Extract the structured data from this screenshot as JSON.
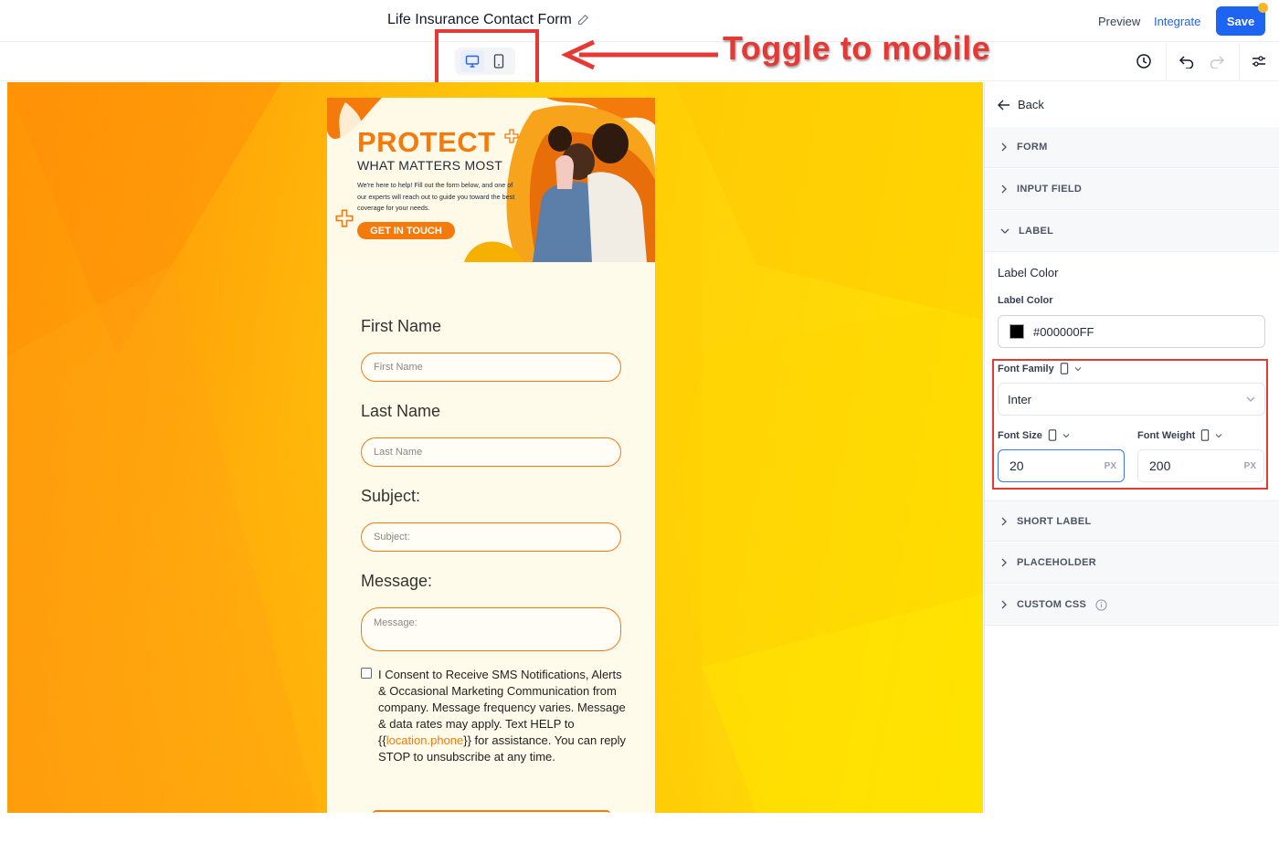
{
  "header": {
    "form_title": "Life Insurance Contact Form",
    "preview_label": "Preview",
    "integrate_label": "Integrate",
    "save_label": "Save"
  },
  "annotation": {
    "toggle_text": "Toggle to mobile",
    "color": "#e53935"
  },
  "toolbar": {
    "device_modes": [
      "desktop",
      "mobile"
    ],
    "active_device": "desktop",
    "icons": [
      "history-icon",
      "undo-icon",
      "redo-icon",
      "settings-sliders-icon"
    ]
  },
  "form": {
    "hero": {
      "headline": "PROTECT",
      "subheadline": "WHAT MATTERS MOST",
      "body": "We're here to help! Fill out the form below, and one of our experts will reach out to guide you toward the best coverage for your needs.",
      "cta": "GET IN TOUCH"
    },
    "fields": [
      {
        "label": "First Name",
        "placeholder": "First Name"
      },
      {
        "label": "Last Name",
        "placeholder": "Last Name"
      },
      {
        "label": "Subject:",
        "placeholder": "Subject:"
      },
      {
        "label": "Message:",
        "placeholder": "Message:"
      }
    ],
    "consent": {
      "text_before": "I Consent to Receive SMS Notifications, Alerts & Occasional Marketing Communication from company. Message frequency varies. Message & data rates may apply. Text HELP to {{",
      "link": "location.phone",
      "text_after": "}} for assistance. You can reply STOP to unsubscribe at any time."
    },
    "accent_color": "#f47a0b"
  },
  "panel": {
    "back_label": "Back",
    "sections_top": [
      "FORM",
      "INPUT FIELD",
      "LABEL"
    ],
    "label_section": {
      "heading": "Label Color",
      "color_label": "Label Color",
      "color_value": "#000000FF",
      "font_family_label": "Font Family",
      "font_family_value": "Inter",
      "font_size_label": "Font Size",
      "font_size_value": "20",
      "font_weight_label": "Font Weight",
      "font_weight_value": "200",
      "unit": "PX"
    },
    "sections_bottom": [
      "SHORT LABEL",
      "PLACEHOLDER",
      "CUSTOM CSS"
    ]
  }
}
